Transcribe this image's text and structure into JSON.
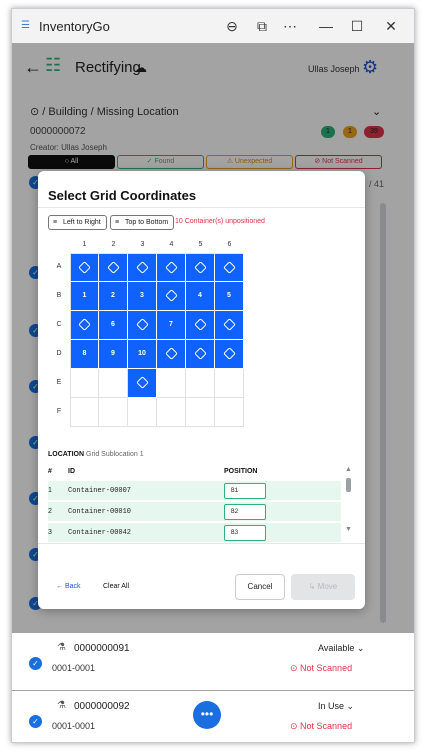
{
  "window": {
    "title": "InventoryGo",
    "controls": [
      "⊖",
      "⧉",
      "⋯",
      "—",
      "☐",
      "✕"
    ]
  },
  "appbar": {
    "title": "Rectifying",
    "user": "Ullas Joseph"
  },
  "page": {
    "location": "/ Building / Missing Location",
    "code": "0000000072",
    "creator": "Creator: Ullas Joseph",
    "badges": [
      {
        "value": "1",
        "color": "#2db37a"
      },
      {
        "value": "1",
        "color": "#f0a020"
      },
      {
        "value": "39",
        "color": "#e0334a"
      }
    ],
    "filters": [
      {
        "label": "○ All",
        "fg": "#ffffff",
        "bg": "#111111",
        "border": "#111111"
      },
      {
        "label": "✓ Found",
        "fg": "#2db37a",
        "bg": "#ffffff",
        "border": "#2db37a"
      },
      {
        "label": "⚠ Unexpected",
        "fg": "#e08a00",
        "bg": "#ffffff",
        "border": "#f0a020"
      },
      {
        "label": "⊘ Not Scanned",
        "fg": "#e0334a",
        "bg": "#ffffff",
        "border": "#e0334a"
      }
    ],
    "counter": "/ 41"
  },
  "items": [
    {
      "id": "0000000091",
      "sub": "0001-0001",
      "status": "Available ⌄",
      "scan": "⊙ Not Scanned"
    },
    {
      "id": "0000000092",
      "sub": "0001-0001",
      "status": "In Use ⌄",
      "scan": "⊙ Not Scanned"
    }
  ],
  "dialog": {
    "title": "Select Grid Coordinates",
    "btn_ltr": "Left to Right",
    "btn_ttb": "Top to Bottom",
    "unpositioned": "10 Container(s) unpositioned",
    "cols": [
      "1",
      "2",
      "3",
      "4",
      "5",
      "6"
    ],
    "rows": [
      "A",
      "B",
      "C",
      "D",
      "E",
      "F"
    ],
    "cells": [
      [
        "cube",
        "cube",
        "cube",
        "cube",
        "cube",
        "cube"
      ],
      [
        "1",
        "2",
        "3",
        "cube",
        "4",
        "5"
      ],
      [
        "cube",
        "6",
        "cube",
        "7",
        "cube",
        "cube"
      ],
      [
        "8",
        "9",
        "10",
        "cube",
        "cube",
        "cube"
      ],
      [
        "",
        "",
        "cube",
        "",
        "",
        ""
      ],
      [
        "",
        "",
        "",
        "",
        "",
        ""
      ]
    ],
    "location_label": "LOCATION",
    "location_sub": "Grid Sublocation 1",
    "table_headers": {
      "num": "#",
      "id": "ID",
      "pos": "POSITION"
    },
    "table_rows": [
      {
        "n": "1",
        "id": "Container-00007",
        "pos": "B1"
      },
      {
        "n": "2",
        "id": "Container-00010",
        "pos": "B2"
      },
      {
        "n": "3",
        "id": "Container-00042",
        "pos": "B3"
      }
    ],
    "back": "← Back",
    "clear_all": "Clear All",
    "cancel": "Cancel",
    "move": "↳ Move"
  }
}
